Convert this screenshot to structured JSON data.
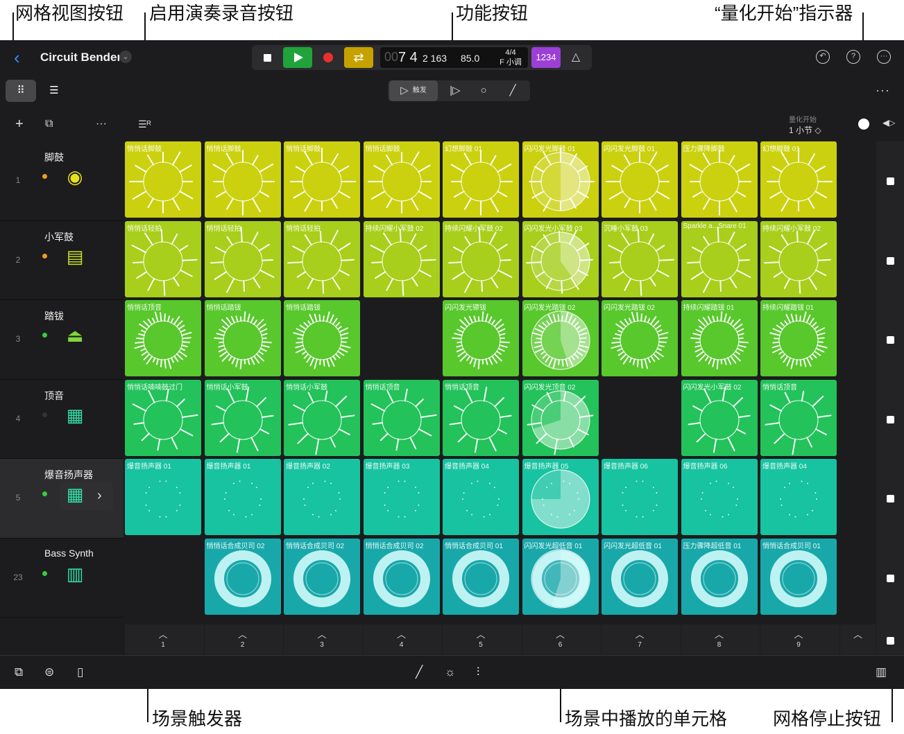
{
  "callouts": {
    "grid_view_button": "网格视图按钮",
    "live_loops_record": "启用演奏录音按钮",
    "function_buttons": "功能按钮",
    "quantize_indicator": "“量化开始”指示器",
    "scene_trigger": "场景触发器",
    "playing_cells": "场景中播放的单元格",
    "grid_stop": "网格停止按钮"
  },
  "header": {
    "back_icon": "chevron-left-icon",
    "song_title": "Circuit Bender",
    "title_menu_icon": "chevron-down-icon"
  },
  "transport": {
    "position_dim": "00",
    "position_bar": "7 4",
    "position_sub": "2 163",
    "tempo": "85.0",
    "time_signature": "4/4",
    "key": "F 小调",
    "count_in": "1234",
    "metronome_icon": "metronome-icon"
  },
  "right_icons": [
    "undo-icon",
    "help-icon",
    "more-icon"
  ],
  "function_bar": {
    "trigger_label": "触发",
    "buttons": [
      "play-trigger-icon",
      "play-from-icon",
      "record-icon",
      "edit-pencil-icon"
    ]
  },
  "quantize": {
    "label": "量化开始",
    "value": "1 小节 ◇"
  },
  "tracks": [
    {
      "num": "1",
      "name": "脚鼓",
      "dot": "#f39a1e",
      "icon": "kick-drum-icon",
      "color": "#cbd10f"
    },
    {
      "num": "2",
      "name": "小军鼓",
      "dot": "#f39a1e",
      "icon": "snare-drum-icon",
      "color": "#a7cf1b"
    },
    {
      "num": "3",
      "name": "踏钹",
      "dot": "#3ccb3c",
      "icon": "hihat-icon",
      "color": "#58c82c"
    },
    {
      "num": "4",
      "name": "顶音",
      "dot": "#333333",
      "icon": "drum-machine-icon",
      "color": "#23c25a"
    },
    {
      "num": "5",
      "name": "爆音扬声器",
      "dot": "#3ccb3c",
      "icon": "drum-machine-icon",
      "color": "#17c3a0"
    },
    {
      "num": "23",
      "name": "Bass Synth",
      "dot": "#3ccb3c",
      "icon": "synth-icon",
      "color": "#19a8aa"
    }
  ],
  "grid": [
    [
      "悄悄话脚鼓",
      "悄悄话脚鼓",
      "悄悄话脚鼓",
      "悄悄话脚鼓",
      "幻想脚鼓 01",
      "闪闪发光脚鼓 01",
      "闪闪发光脚鼓 01",
      "压力骤降脚鼓",
      "幻想脚鼓 01"
    ],
    [
      "悄悄话轻拍",
      "悄悄话轻拍",
      "悄悄话轻拍",
      "持续闪耀小军鼓 02",
      "持续闪耀小军鼓 02",
      "闪闪发光小军鼓 03",
      "沉睡小军鼓 03",
      "Sparkle a...Snare 01",
      "持续闪耀小军鼓 02"
    ],
    [
      "悄悄话顶音",
      "悄悄话踏钹",
      "悄悄话踏钹",
      null,
      "闪闪发光镲钹",
      "闪闪发光踏钹 02",
      "闪闪发光踏钹 02",
      "持续闪耀踏钹 01",
      "持续闪耀踏钹 01"
    ],
    [
      "悄悄话喃喃鼓过门",
      "悄悄话小军鼓",
      "悄悄话小军鼓",
      "悄悄话顶音",
      "悄悄话顶音",
      "闪闪发光顶音 02",
      null,
      "闪闪发光小军鼓 02",
      "悄悄话顶音"
    ],
    [
      "爆音扬声器 01",
      "爆音扬声器 01",
      "爆音扬声器 02",
      "爆音扬声器 03",
      "爆音扬声器 04",
      "爆音扬声器 05",
      "爆音扬声器 06",
      "爆音扬声器 06",
      "爆音扬声器 04"
    ],
    [
      null,
      "悄悄话合成贝司 02",
      "悄悄话合成贝司 02",
      "悄悄话合成贝司 02",
      "悄悄话合成贝司 01",
      "闪闪发光超低音 01",
      "闪闪发光超低音 01",
      "压力骤降超低音 01",
      "悄悄话合成贝司 01"
    ]
  ],
  "playing_column": 6,
  "playing_progress": [
    0.5,
    0.4,
    0.45,
    0.7,
    0.75,
    0.55
  ],
  "scenes": {
    "trigger_icon": "chevron-up-icon",
    "numbers": [
      "1",
      "2",
      "3",
      "4",
      "5",
      "6",
      "7",
      "8",
      "9"
    ]
  },
  "bottom_icons": [
    "library-icon",
    "toggle-icon",
    "inspector-icon",
    "pencil-icon",
    "brightness-icon",
    "mixer-icon",
    "keyboard-icon"
  ]
}
